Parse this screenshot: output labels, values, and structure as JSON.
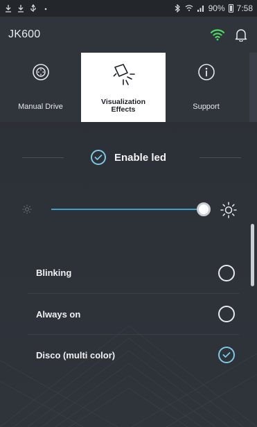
{
  "status_bar": {
    "battery_percent": "90%",
    "time": "7:58",
    "left_icons": [
      "download-icon",
      "download-icon",
      "usb-icon",
      "dot-icon"
    ],
    "right_icons": [
      "bluetooth-icon",
      "wifi-icon",
      "signal-icon",
      "battery-icon"
    ]
  },
  "app_bar": {
    "title": "JK600",
    "wifi_color": "#4cd964",
    "icons": [
      "wifi-icon",
      "bell-icon"
    ]
  },
  "tabs": [
    {
      "label": "Manual Drive",
      "icon": "gamepad-icon",
      "active": false
    },
    {
      "label": "Visualization Effects",
      "icon": "spotlight-icon",
      "active": true
    },
    {
      "label": "Support",
      "icon": "info-icon",
      "active": false
    }
  ],
  "enable_led": {
    "label": "Enable led",
    "checked": true
  },
  "brightness": {
    "level": 1.0,
    "accent_color": "#3f9fc6"
  },
  "options": [
    {
      "label": "Blinking",
      "selected": false
    },
    {
      "label": "Always on",
      "selected": false
    },
    {
      "label": "Disco (multi color)",
      "selected": true
    }
  ],
  "colors": {
    "background": "#2d3138",
    "accent": "#7ec8e3"
  }
}
